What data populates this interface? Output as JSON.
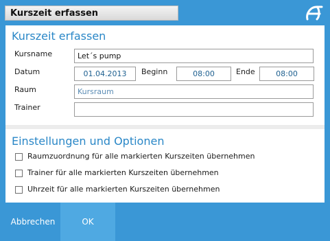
{
  "window": {
    "title": "Kurszeit erfassen"
  },
  "icons": {
    "logo": "brand-logo-icon",
    "checkbox": "checkbox-icon"
  },
  "colors": {
    "accent": "#3a97d6",
    "section_title": "#2a87c7",
    "ok_button": "#4fa9e2"
  },
  "form": {
    "heading": "Kurszeit erfassen",
    "kursname_label": "Kursname",
    "kursname_value": "Let´s pump",
    "datum_label": "Datum",
    "datum_value": "01.04.2013",
    "beginn_label": "Beginn",
    "beginn_value": "08:00",
    "ende_label": "Ende",
    "ende_value": "08:00",
    "raum_label": "Raum",
    "raum_placeholder": "Kursraum",
    "trainer_label": "Trainer",
    "trainer_value": ""
  },
  "options": {
    "heading": "Einstellungen und Optionen",
    "items": [
      {
        "label": "Raumzuordnung für alle markierten Kurszeiten übernehmen",
        "checked": false
      },
      {
        "label": "Trainer für alle markierten Kurszeiten übernehmen",
        "checked": false
      },
      {
        "label": "Uhrzeit für alle markierten Kurszeiten übernehmen",
        "checked": false
      }
    ]
  },
  "buttons": {
    "cancel": "Abbrechen",
    "ok": "OK"
  }
}
